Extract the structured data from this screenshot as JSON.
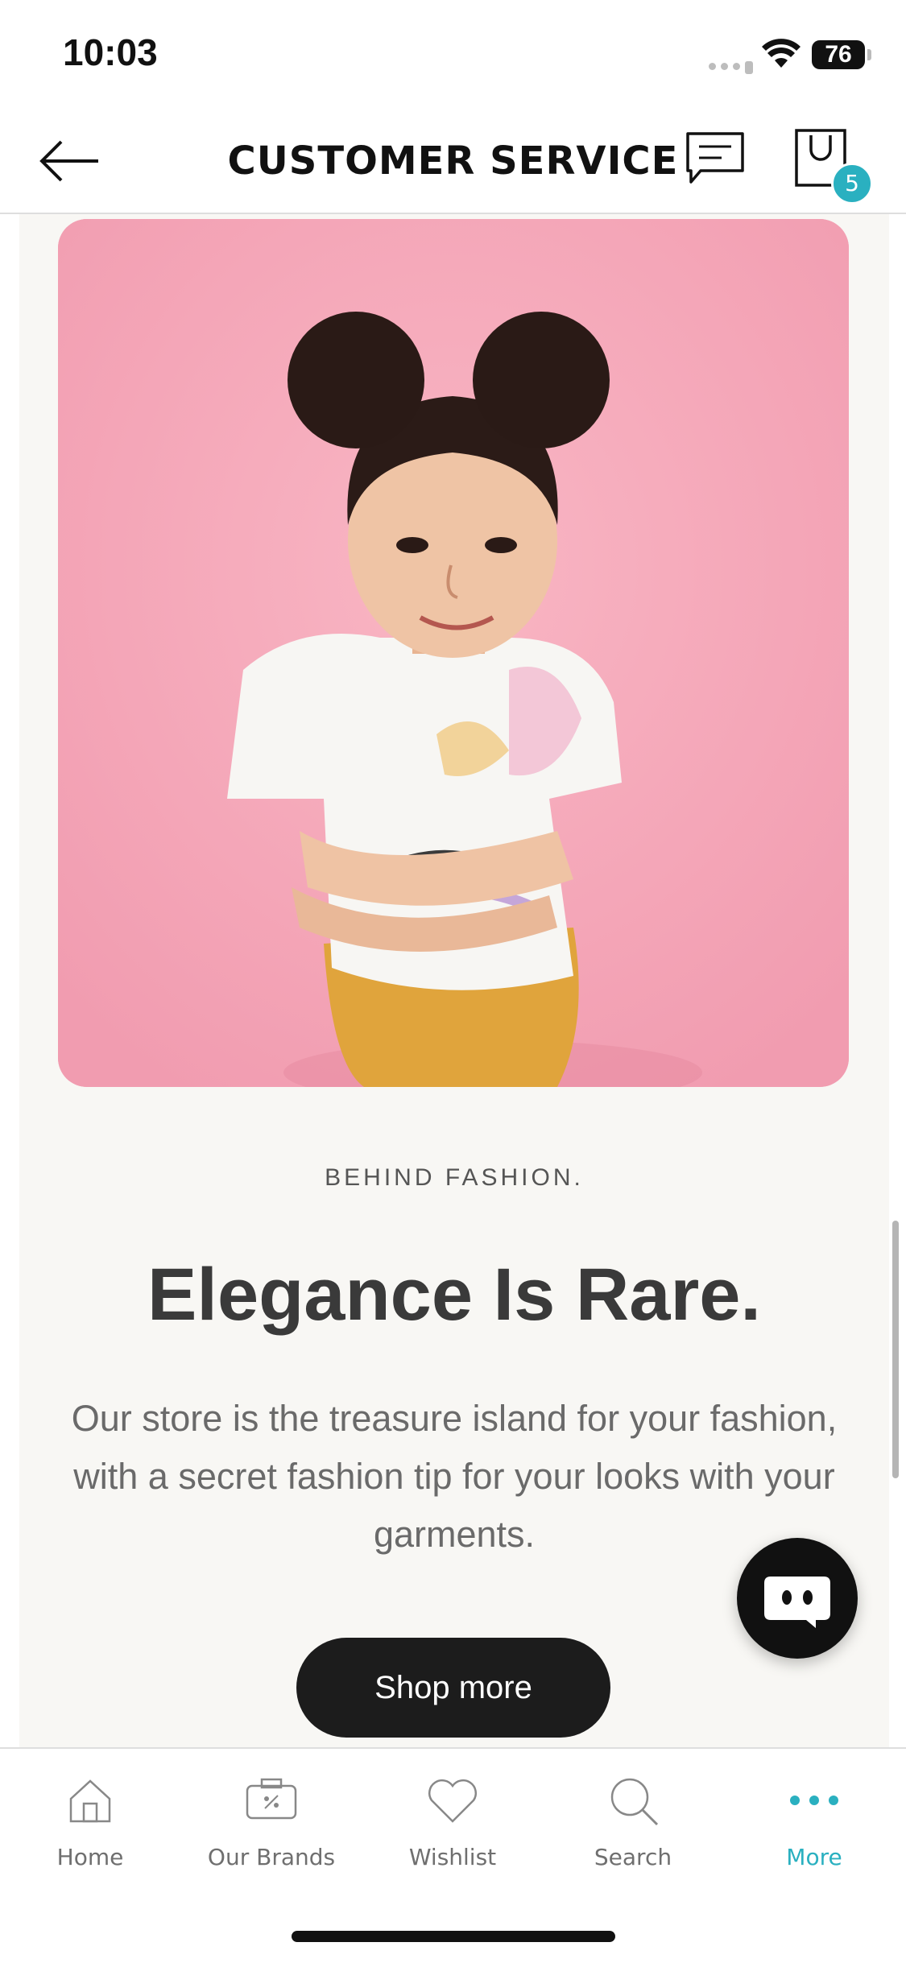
{
  "status_bar": {
    "time": "10:03",
    "battery": "76"
  },
  "header": {
    "title": "CUSTOMER SERVICE",
    "cart_count": "5"
  },
  "hero": {
    "image": "girl-with-space-buns-pink-background"
  },
  "promo": {
    "eyebrow": "BEHIND FASHION.",
    "headline": "Elegance Is Rare.",
    "description": "Our store is the treasure island for your fashion, with a secret fashion tip for your looks with your garments.",
    "button_label": "Shop more"
  },
  "tabbar": {
    "items": [
      {
        "label": "Home",
        "icon": "home-icon"
      },
      {
        "label": "Our Brands",
        "icon": "brands-icon"
      },
      {
        "label": "Wishlist",
        "icon": "heart-icon"
      },
      {
        "label": "Search",
        "icon": "search-icon"
      },
      {
        "label": "More",
        "icon": "more-icon",
        "active": true
      }
    ]
  },
  "colors": {
    "accent": "#2ab0c0",
    "button": "#1c1c1c",
    "hero_bg": "#f6a9ba",
    "page_bg": "#f8f7f4"
  }
}
